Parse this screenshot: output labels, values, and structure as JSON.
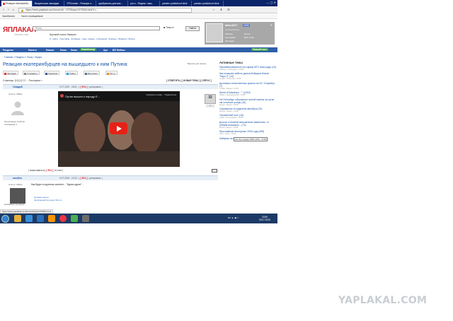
{
  "browser": {
    "tabs": [
      {
        "label": "Реакция екатеринбу...",
        "active": true
      },
      {
        "label": "Визуальные закладки"
      },
      {
        "label": "YPDomain - Реакция е..."
      },
      {
        "label": "одобрасень для вас..."
      },
      {
        "label": "ya.ru - Яндекс: наш..."
      },
      {
        "label": "yandex poddubnof.click"
      },
      {
        "label": "yandex poddubnof.click"
      }
    ],
    "url": "https://www.yaplakal.com/forum/st/...1975/topic1975264.html?v=...",
    "bookmarks": [
      "Закобанить",
      "Часто посещаемые"
    ]
  },
  "site": {
    "logo": "ЯПЛАКАЛ",
    "logo_sub": "YAPLAKAL.COM",
    "search_placeholder": "Поиск...",
    "themes_label": "Темы",
    "find_button": "Найти",
    "slogan": "Крупкий поиск бывших",
    "top_links": [
      "О сайте",
      "Участники",
      "Активные темы",
      "Новые сообщения",
      "Помощь",
      "Правила",
      "Поиски"
    ],
    "user": {
      "name": "fallen1977",
      "count": "1808",
      "rank": "Клубный Ячень",
      "links_left": [
        "Кабинет",
        "Настройки",
        "Закладки"
      ],
      "links_right": [
        "Почта",
        "Мои темы"
      ]
    },
    "menu": [
      "Разделы",
      "Ничего",
      "Новые",
      "Ньюс",
      "Ньюс",
      "НовоКолор",
      "Арт",
      "ВП Фейсы",
      "Новый пост"
    ]
  },
  "breadcrumb": "Главная » Разделы » Пишу » Видео",
  "topic": {
    "title": "Реакция екатеринбурцев на вышедшего к ним Путина",
    "right_link": "Версия для печати",
    "share": [
      {
        "label": "Закладки",
        "color": "#d33"
      },
      {
        "label": "Отправить",
        "color": "#888"
      },
      {
        "label": "Facebook",
        "color": "#3b5998"
      },
      {
        "label": "Twitter",
        "color": "#1da1f2"
      },
      {
        "label": "Вконтакте",
        "color": "#4a76a8"
      },
      {
        "label": "ОК.ru",
        "color": "#f58220"
      }
    ],
    "pages": "Страницы: (10) [1] 2 3 ... Последняя »",
    "actions": "[ ОТВЕТИТЬ ] [ НОВАЯ ТЕМА ] [ ОПРОС ]"
  },
  "post": {
    "author": "Оладий",
    "date_prefix": "9.07.2019 - 18:51",
    "number": "[ Ф11 ]",
    "citation": "| цитировать |",
    "status": "Статус: Offline",
    "role": "Патриот",
    "registered": "Регистрация: 10.06.16",
    "messages": "Сообщений: 1",
    "video_title": "Путин вышел к народу Е...",
    "video_later": "Смотреть позже",
    "video_share": "Поделиться",
    "rating": "32",
    "rating_up": "+/-",
    "footer_prefix": "| пожаловаться |",
    "footer_number": "[ Ф11 ]",
    "footer_suffix": "| в член |"
  },
  "post2": {
    "author": "котэбос",
    "date": "9.07.2019 - 19:24",
    "number": "[ Ф11 ]",
    "citation": "| цитировать |",
    "status": "Статус: Offline",
    "text": "Как будто в курятник залетел... \"Курли-курли\"...",
    "sig1": "Ручками смешн...",
    "sig2": "Залипающий интернет Мос ф...",
    "regs": "Комбайбер прогрерса"
  },
  "sidebar": {
    "title": "Активные темы",
    "items": [
      {
        "title": "Переименованности на тариф МТС вниз ради (19)",
        "meta": "Ювелир  •  Свободное  •  19:58"
      },
      {
        "title": "Как отражать кабель дальнобойщика Быков \"Барс-2\" (10)",
        "meta": "Leraldi  •  Политика  •  19:58"
      },
      {
        "title": "Доставка отечественных кранов на ОС «Нормёр» (7)",
        "meta": "Leraldi  •  Видео  •  19:58"
      },
      {
        "title": "World of Warships - \"\" (1015)",
        "meta": "Яковл  •  Ненормальное  •  19:58"
      },
      {
        "title": "На Петербург обрушился третий ливень за сутки пм осталась улицы (16)",
        "meta": "ibestor  •  Видео  •  19:58"
      },
      {
        "title": "Самокатчик vs водитель автобуса (19)",
        "meta": "fleshka  •  Видео  •  19:58"
      },
      {
        "title": "Угроженный пост (16)",
        "meta": "Lelgot  •  Фотография  •  19:58"
      },
      {
        "title": "Доступ к сетевой изношенной заявлении, то трёмов возможно... (73)",
        "meta": "Белий  •  Видео  •  19:58"
      },
      {
        "title": "Ярославские векторные 1930 года (285)",
        "meta": "Kirov  •  Фото  •  19:58"
      },
      {
        "title": "Лайфхак на вложки (18)",
        "meta": ""
      }
    ],
    "tooltip": "На чём создано 8301,2019 - 13:84"
  },
  "status_url": "https://www.yaplakal.com/forum2/topic1975841.html",
  "taskbar": {
    "tray": "RU  ▲  ◀)  ⚐",
    "time": "19:59",
    "date": "09.07.2019"
  },
  "watermark": "YAPLAKAL.COM"
}
